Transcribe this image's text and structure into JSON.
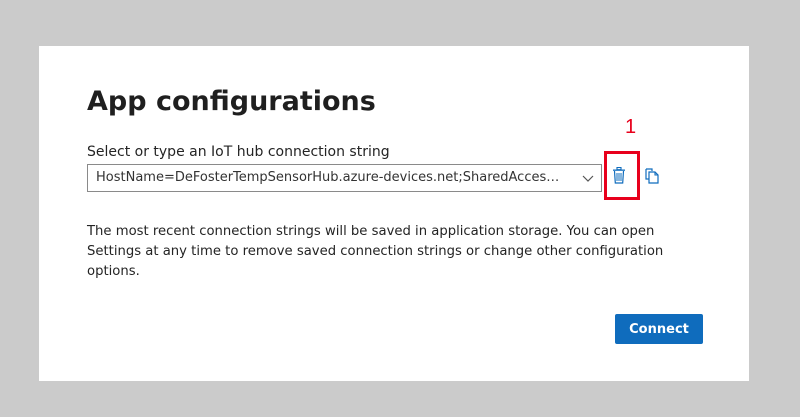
{
  "dialog": {
    "title": "App configurations",
    "connection_label": "Select or type an IoT hub connection string",
    "connection_value": "HostName=DeFosterTempSensorHub.azure-devices.net;SharedAccessKeyName...",
    "description": "The most recent connection strings will be saved in application storage. You can open Settings at any time to remove saved connection strings or change other configuration options.",
    "connect_label": "Connect"
  },
  "annotation": {
    "callout_number": "1"
  },
  "icons": {
    "delete": "trash-icon",
    "copy": "copy-icon",
    "dropdown": "chevron-down-icon"
  },
  "colors": {
    "accent": "#0f6cbd",
    "callout": "#e8001c",
    "backdrop": "#cbcbcb"
  }
}
